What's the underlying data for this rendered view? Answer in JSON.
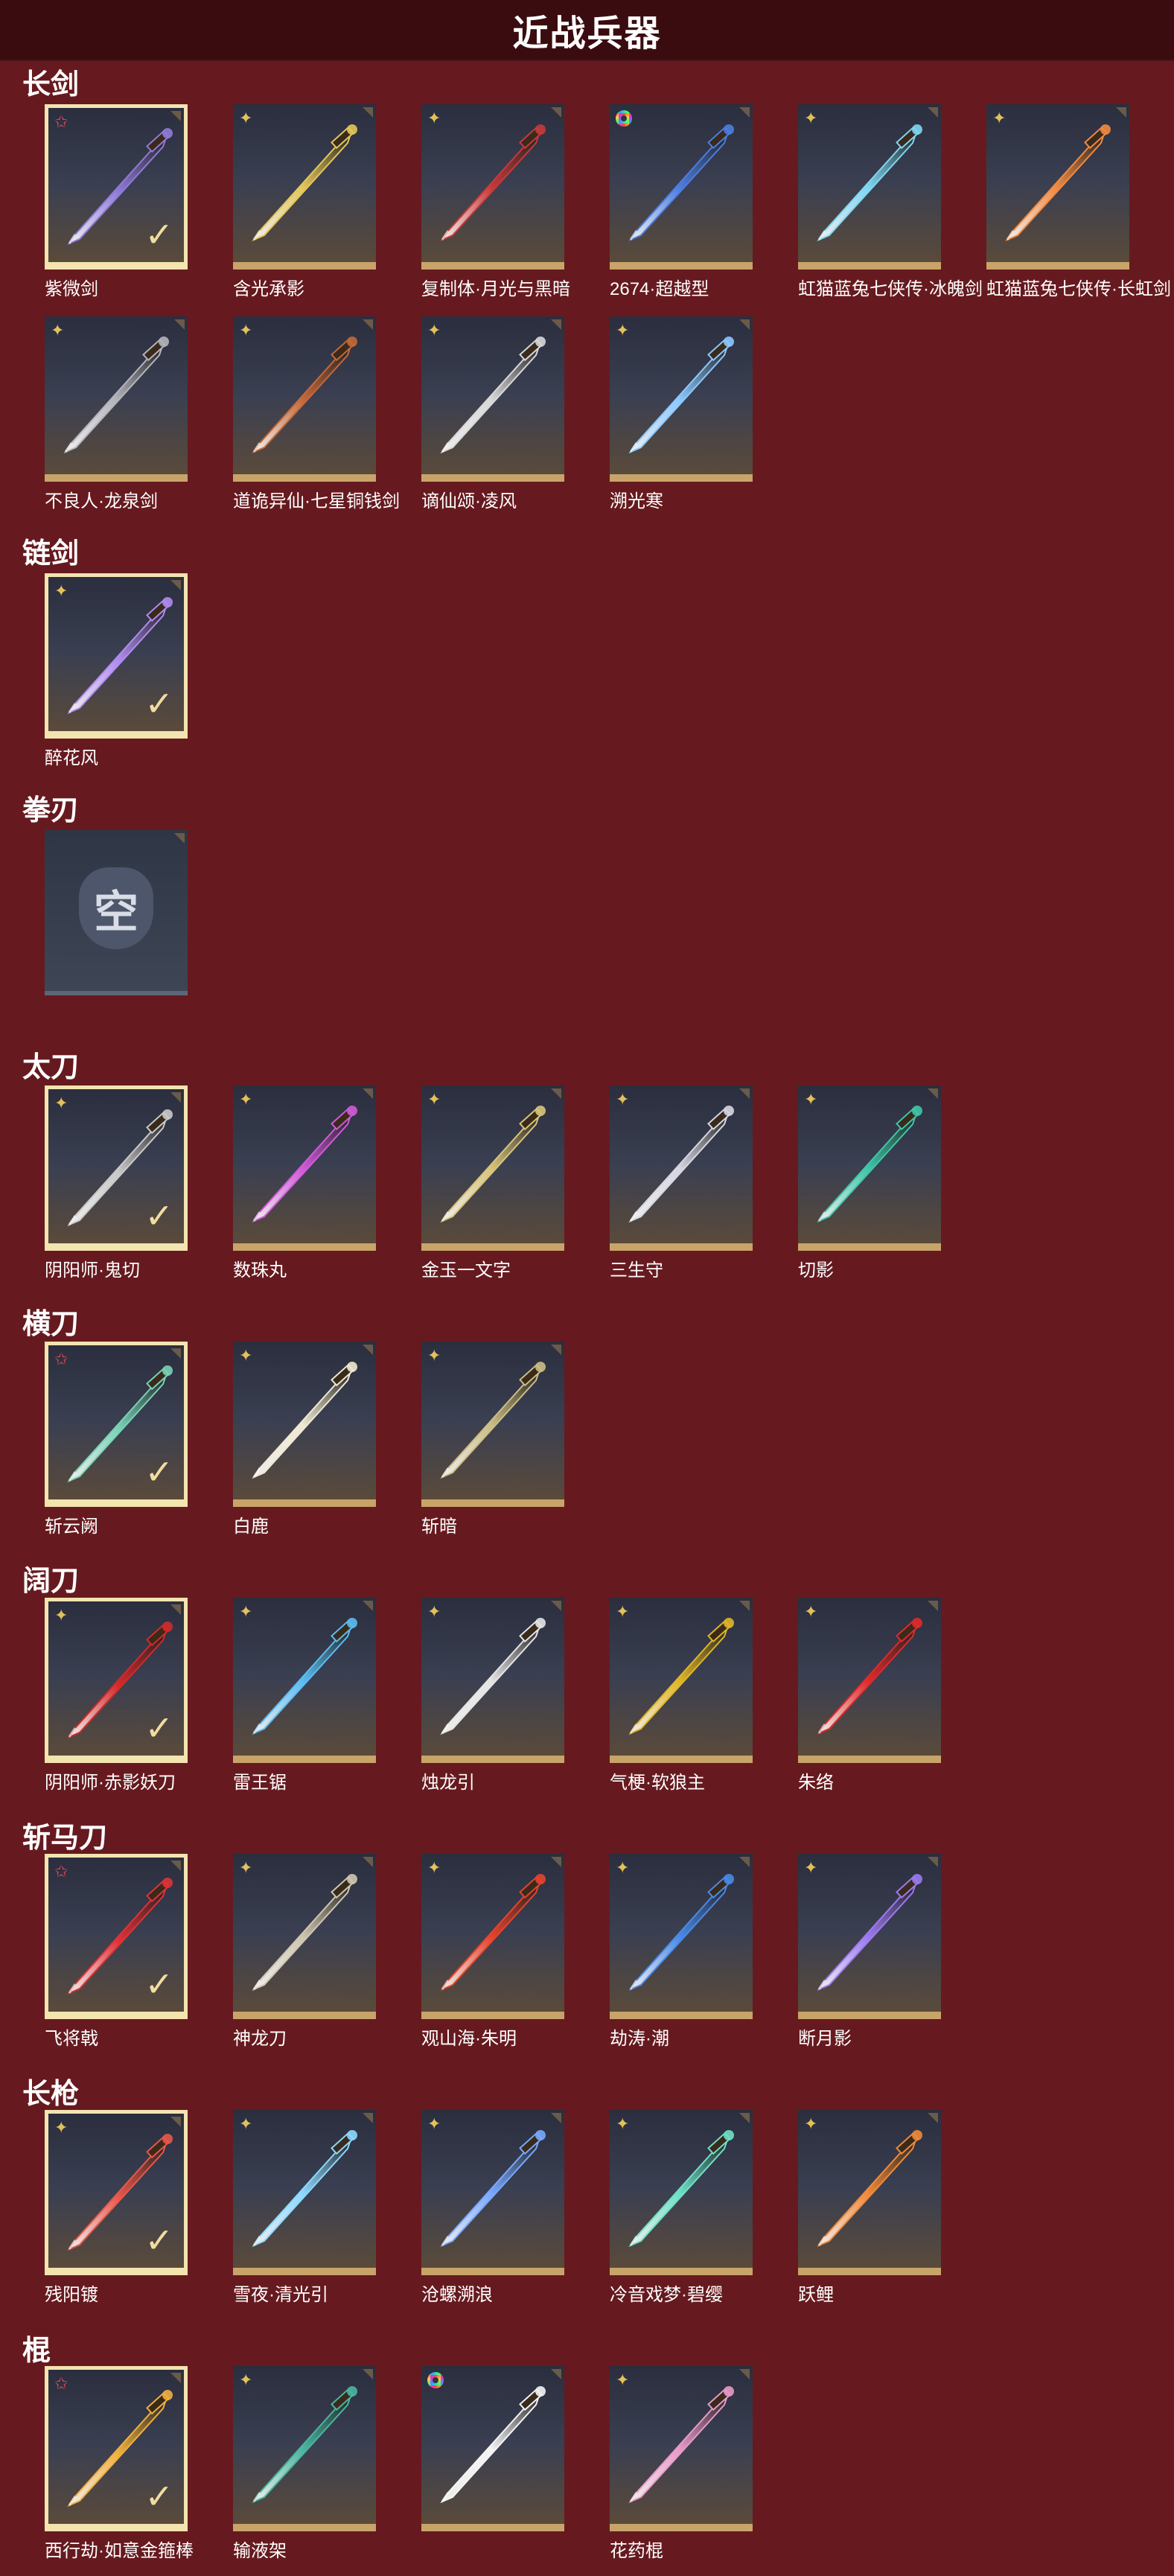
{
  "header": {
    "title": "近战兵器"
  },
  "sections": [
    {
      "title": "长剑",
      "items": [
        {
          "name": "紫微剑",
          "badge": "red",
          "selected": true,
          "color": "#8f7bd8"
        },
        {
          "name": "含光承影",
          "badge": "star",
          "selected": false,
          "color": "#e3c65a"
        },
        {
          "name": "复制体·月光与黑暗",
          "badge": "star",
          "selected": false,
          "color": "#c73a3a"
        },
        {
          "name": "2674·超越型",
          "badge": "ring",
          "selected": false,
          "color": "#4c7de0"
        },
        {
          "name": "虹猫蓝兔七侠传·冰魄剑",
          "badge": "star",
          "selected": false,
          "color": "#7fd6f2"
        },
        {
          "name": "虹猫蓝兔七侠传·长虹剑",
          "badge": "star",
          "selected": false,
          "color": "#f08a42"
        },
        {
          "name": "不良人·龙泉剑",
          "badge": "star",
          "selected": false,
          "color": "#b4b4bc"
        },
        {
          "name": "道诡异仙·七星铜钱剑",
          "badge": "star",
          "selected": false,
          "color": "#c4683a"
        },
        {
          "name": "谪仙颂·凌风",
          "badge": "star",
          "selected": false,
          "color": "#d8d8d8"
        },
        {
          "name": "溯光寒",
          "badge": "star",
          "selected": false,
          "color": "#8cc8ff"
        }
      ]
    },
    {
      "title": "链剑",
      "items": [
        {
          "name": "醉花风",
          "badge": "star",
          "selected": true,
          "color": "#b08cf0"
        }
      ]
    },
    {
      "title": "拳刃",
      "items": [
        {
          "name": "",
          "badge": "none",
          "selected": false,
          "empty": true,
          "empty_glyph": "空"
        }
      ]
    },
    {
      "title": "太刀",
      "items": [
        {
          "name": "阴阳师·鬼切",
          "badge": "star",
          "selected": true,
          "color": "#c9c9c9"
        },
        {
          "name": "数珠丸",
          "badge": "star",
          "selected": false,
          "color": "#d05ad8"
        },
        {
          "name": "金玉一文字",
          "badge": "star",
          "selected": false,
          "color": "#d8c47a"
        },
        {
          "name": "三生守",
          "badge": "star",
          "selected": false,
          "color": "#d6d6e2"
        },
        {
          "name": "切影",
          "badge": "star",
          "selected": false,
          "color": "#3fc6a8"
        }
      ]
    },
    {
      "title": "横刀",
      "items": [
        {
          "name": "斩云阙",
          "badge": "red",
          "selected": true,
          "color": "#7ad2b6"
        },
        {
          "name": "白鹿",
          "badge": "star",
          "selected": false,
          "color": "#efe8d2"
        },
        {
          "name": "斩暗",
          "badge": "star",
          "selected": false,
          "color": "#cbbd84"
        }
      ]
    },
    {
      "title": "阔刀",
      "items": [
        {
          "name": "阴阳师·赤影妖刀",
          "badge": "star",
          "selected": true,
          "color": "#d22a2a"
        },
        {
          "name": "雷王锯",
          "badge": "star",
          "selected": false,
          "color": "#5cbcf0"
        },
        {
          "name": "烛龙引",
          "badge": "star",
          "selected": false,
          "color": "#e4e4e4"
        },
        {
          "name": "气梗·软狼主",
          "badge": "star",
          "selected": false,
          "color": "#e0b628"
        },
        {
          "name": "朱络",
          "badge": "star",
          "selected": false,
          "color": "#e02a2a"
        }
      ]
    },
    {
      "title": "斩马刀",
      "items": [
        {
          "name": "飞将戟",
          "badge": "red",
          "selected": true,
          "color": "#e03238"
        },
        {
          "name": "神龙刀",
          "badge": "star",
          "selected": false,
          "color": "#cfc6b0"
        },
        {
          "name": "观山海·朱明",
          "badge": "star",
          "selected": false,
          "color": "#e6442c"
        },
        {
          "name": "劫涛·潮",
          "badge": "star",
          "selected": false,
          "color": "#4a8ae8"
        },
        {
          "name": "断月影",
          "badge": "star",
          "selected": false,
          "color": "#9c7af0"
        }
      ]
    },
    {
      "title": "长枪",
      "items": [
        {
          "name": "残阳镀",
          "badge": "star",
          "selected": true,
          "color": "#e8584a"
        },
        {
          "name": "雪夜·清光引",
          "badge": "star",
          "selected": false,
          "color": "#8cd8ff"
        },
        {
          "name": "沧螺溯浪",
          "badge": "star",
          "selected": false,
          "color": "#7aa8ff"
        },
        {
          "name": "冷音戏梦·碧缨",
          "badge": "star",
          "selected": false,
          "color": "#6ee0c6"
        },
        {
          "name": "跃鲤",
          "badge": "star",
          "selected": false,
          "color": "#f08a3a"
        }
      ]
    },
    {
      "title": "棍",
      "items": [
        {
          "name": "西行劫·如意金箍棒",
          "badge": "red",
          "selected": true,
          "color": "#f0b040"
        },
        {
          "name": "输液架",
          "badge": "star",
          "selected": false,
          "color": "#4ab6a0"
        },
        {
          "name": "",
          "badge": "ring",
          "selected": false,
          "color": "#f4f4f4"
        },
        {
          "name": "花药棍",
          "badge": "star",
          "selected": false,
          "color": "#e89ac8"
        }
      ]
    }
  ]
}
